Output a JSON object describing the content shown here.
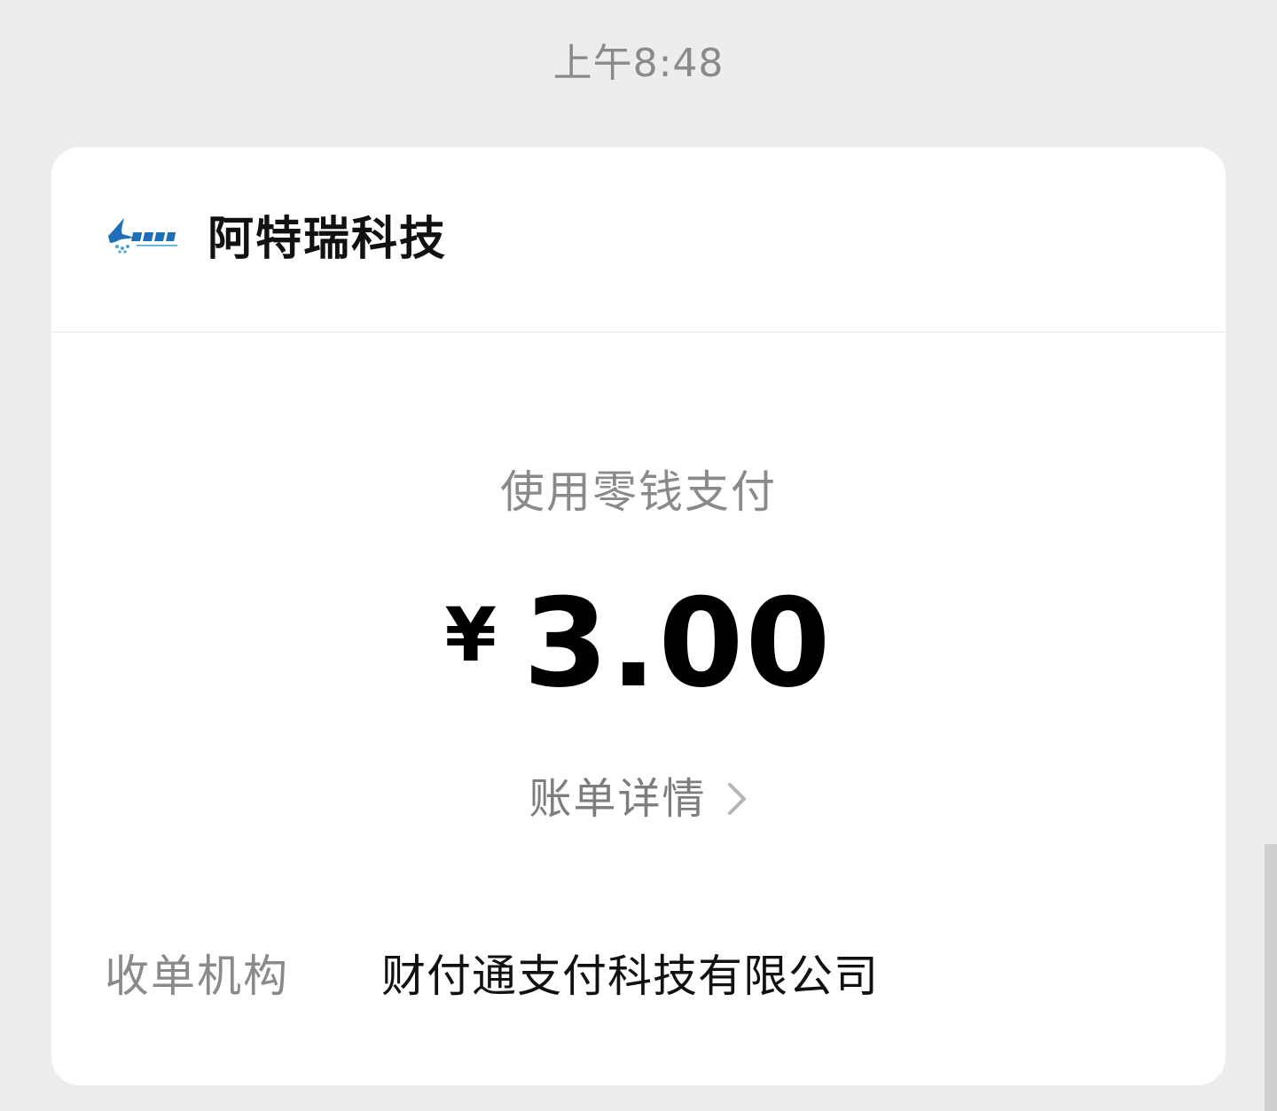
{
  "timestamp": "上午8:48",
  "merchant": {
    "logo_icon": "merchant-logo-icon",
    "name": "阿特瑞科技",
    "logo_color": "#1f6fb8"
  },
  "payment": {
    "method": "使用零钱支付",
    "currency_symbol": "¥",
    "amount": "3.00",
    "detail_label": "账单详情"
  },
  "info": {
    "acquirer_label": "收单机构",
    "acquirer_value": "财付通支付科技有限公司"
  }
}
